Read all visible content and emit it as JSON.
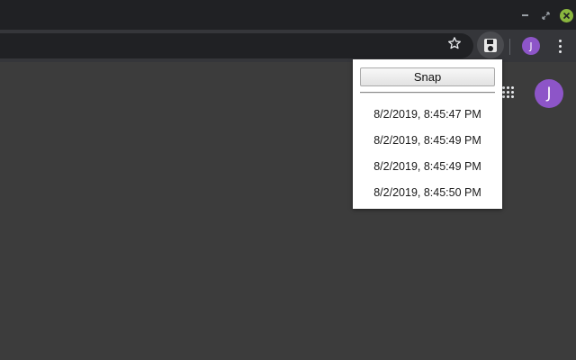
{
  "window": {
    "controls": [
      "minimize",
      "restore",
      "close"
    ],
    "close_color": "#8ab63e"
  },
  "toolbar": {
    "profile_initial": "J",
    "profile_color": "#8d55c8",
    "bookmark_icon": "star-outline-icon",
    "extension_icon": "floppy-disk-icon",
    "menu_icon": "vertical-dots-icon"
  },
  "page": {
    "profile_initial": "J",
    "apps_icon": "apps-grid-icon"
  },
  "popup": {
    "snap_label": "Snap",
    "snapshots": [
      "8/2/2019, 8:45:47 PM",
      "8/2/2019, 8:45:49 PM",
      "8/2/2019, 8:45:49 PM",
      "8/2/2019, 8:45:50 PM"
    ]
  }
}
